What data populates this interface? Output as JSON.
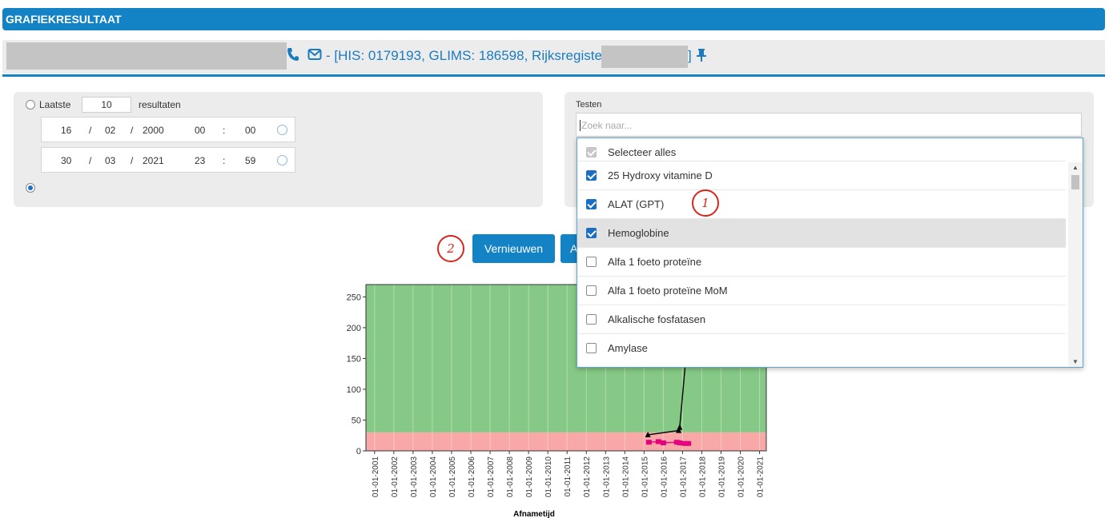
{
  "header": {
    "title": "GRAFIEKRESULTAAT"
  },
  "patient": {
    "info_text": "- [HIS: 0179193, GLIMS: 186598, Rijksregister",
    "closing_bracket": "]",
    "phone_icon": "phone-icon",
    "mail_icon": "envelope-icon",
    "pin_icon": "pin-icon"
  },
  "filters": {
    "last_label": "Laatste",
    "last_value": "10",
    "results_label": "resultaten",
    "from": {
      "day": "16",
      "month": "02",
      "year": "2000",
      "hour": "00",
      "minute": "00"
    },
    "to": {
      "day": "30",
      "month": "03",
      "year": "2021",
      "hour": "23",
      "minute": "59"
    },
    "sep_slash": "/",
    "sep_colon": ":"
  },
  "tests": {
    "label": "Testen",
    "search_placeholder": "Zoek naar...",
    "select_all": "Selecteer alles",
    "options": [
      {
        "label": "25 Hydroxy vitamine D",
        "checked": true
      },
      {
        "label": "ALAT (GPT)",
        "checked": true
      },
      {
        "label": "Hemoglobine",
        "checked": true,
        "highlighted": true
      },
      {
        "label": "Alfa 1 foeto proteïne",
        "checked": false
      },
      {
        "label": "Alfa 1 foeto proteïne MoM",
        "checked": false
      },
      {
        "label": "Alkalische fosfatasen",
        "checked": false
      },
      {
        "label": "Amylase",
        "checked": false
      }
    ]
  },
  "actions": {
    "refresh": "Vernieuwen",
    "second_partial": "A"
  },
  "annotations": {
    "one": "1",
    "two": "2"
  },
  "colors": {
    "accent": "#1383c6",
    "normal_band": "#86c986",
    "low_band": "#f9a8a8",
    "series_pink": "#e6007e"
  },
  "chart_data": {
    "type": "line",
    "xlabel": "Afnametijd",
    "ylabel": "",
    "ylim": [
      0,
      270
    ],
    "yticks": [
      0,
      50,
      100,
      150,
      200,
      250
    ],
    "x_tick_labels": [
      "01-01-2001",
      "01-01-2002",
      "01-01-2003",
      "01-01-2004",
      "01-01-2005",
      "01-01-2006",
      "01-01-2007",
      "01-01-2008",
      "01-01-2009",
      "01-01-2010",
      "01-01-2011",
      "01-01-2012",
      "01-01-2013",
      "01-01-2014",
      "01-01-2015",
      "01-01-2016",
      "01-01-2017",
      "01-01-2018",
      "01-01-2019",
      "01-01-2020",
      "01-01-2021"
    ],
    "bands": [
      {
        "from": 30,
        "to": 270,
        "color": "#86c986"
      },
      {
        "from": 0,
        "to": 30,
        "color": "#f9a8a8"
      }
    ],
    "series": [
      {
        "color": "#000000",
        "marker": "triangle",
        "x": [
          2015.2,
          2016.8,
          2016.85,
          2017.2
        ],
        "y": [
          26,
          33,
          38,
          160
        ]
      },
      {
        "color": "#e6007e",
        "marker": "square",
        "x": [
          2015.25,
          2015.75,
          2016.0,
          2016.7,
          2016.85,
          2017.1,
          2017.3
        ],
        "y": [
          14,
          15,
          13,
          14,
          13,
          12,
          12
        ]
      }
    ]
  }
}
